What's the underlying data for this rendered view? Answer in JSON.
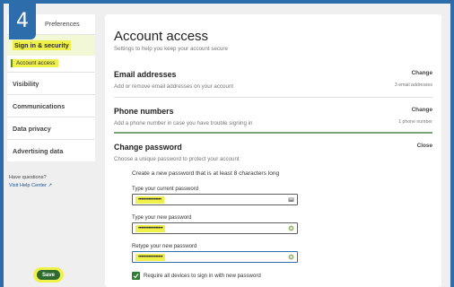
{
  "step_number": "4",
  "sidebar": {
    "top_item": "Preferences",
    "security": "Sign in & security",
    "sub_item": "Account access",
    "items": [
      "Visibility",
      "Communications",
      "Data privacy",
      "Advertising data"
    ],
    "help_text": "Have questions?",
    "help_link": "Visit Help Center"
  },
  "main": {
    "title": "Account access",
    "subtitle": "Settings to help you keep your account secure",
    "email": {
      "title": "Email addresses",
      "desc": "Add or remove email addresses on your account",
      "action": "Change",
      "meta": "3 email addresses"
    },
    "phone": {
      "title": "Phone numbers",
      "desc": "Add a phone number in case you have trouble signing in",
      "action": "Change",
      "meta": "1 phone number"
    },
    "password": {
      "title": "Change password",
      "desc": "Choose a unique password to protect your account",
      "action": "Close",
      "intro": "Create a new password that is at least 8 characters long",
      "current_label": "Type your current password",
      "current_value": "••••••••••••••••",
      "new_label": "Type your new password",
      "new_value": "•••••••••••••••••",
      "retype_label": "Retype your new password",
      "retype_value": "•••••••••••••••••",
      "checkbox_label": "Require all devices to sign in with new password",
      "save_label": "Save"
    }
  },
  "colors": {
    "highlight": "#f0f04a",
    "primary_green": "#2f6b2f",
    "frame_blue": "#2e6dac"
  }
}
